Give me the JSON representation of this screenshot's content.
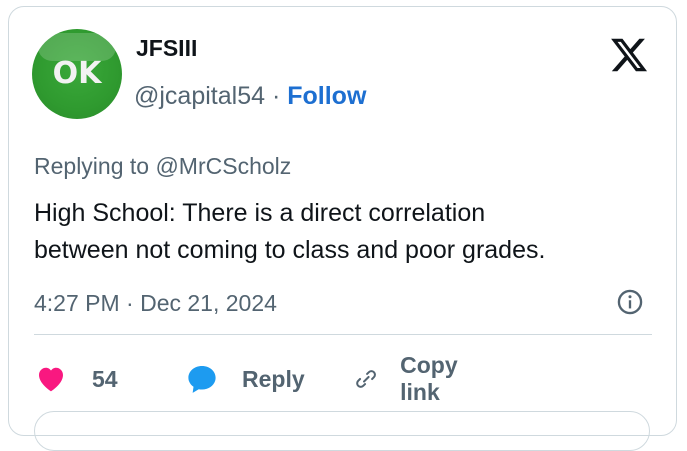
{
  "author": {
    "display_name": "JFSIII",
    "handle": "@jcapital54",
    "separator": "·",
    "follow_label": "Follow",
    "avatar_text": "OK",
    "avatar_color": "#2f9a2f"
  },
  "tweet": {
    "replying_to": "Replying to @MrCScholz",
    "text_line1": "High School: There is a direct correlation",
    "text_line2": "between not coming to class and poor grades.",
    "timestamp": "4:27 PM · Dec 21, 2024"
  },
  "actions": {
    "like_count": "54",
    "reply_label": "Reply",
    "copy_link_label": "Copy link"
  },
  "icons": [
    "x-logo-icon",
    "info-icon",
    "heart-icon",
    "reply-bubble-icon",
    "link-icon"
  ],
  "colors": {
    "follow": "#1d6fd1",
    "heart": "#f91880",
    "reply_bubble": "#1d9bf0",
    "muted_text": "#536471",
    "border": "#cfd9de"
  }
}
